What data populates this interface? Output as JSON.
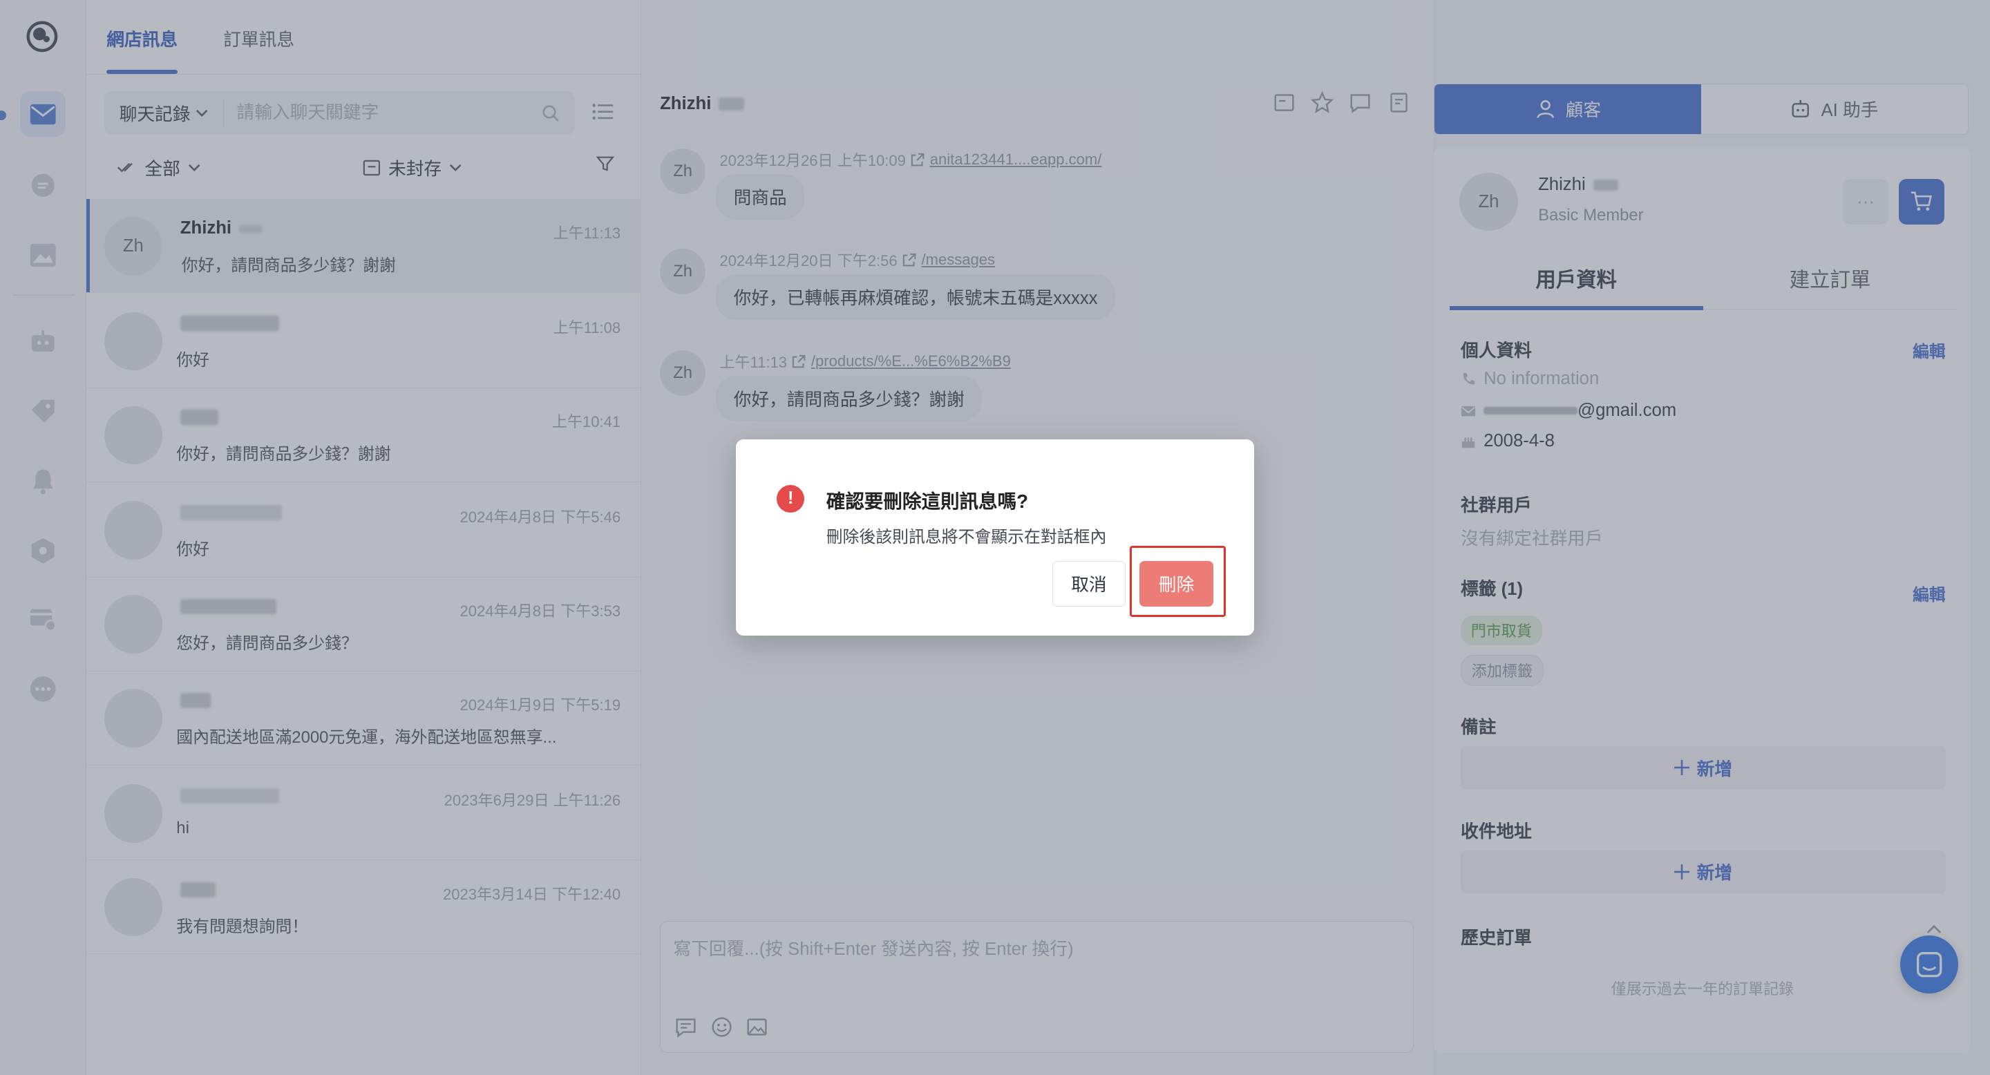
{
  "nav": {
    "tabs": [
      {
        "label": "網店訊息",
        "active": true
      },
      {
        "label": "訂單訊息",
        "active": false
      }
    ],
    "rail_icons": [
      "mail-icon",
      "chat-icon",
      "image-icon",
      "robot-icon",
      "tag-icon",
      "bell-icon",
      "package-icon",
      "card-settings-icon",
      "more-icon"
    ]
  },
  "search": {
    "scope_label": "聊天記錄",
    "placeholder": "請輸入聊天關鍵字"
  },
  "filters": {
    "all_label": "全部",
    "archive_label": "未封存"
  },
  "conversations": [
    {
      "avatar": "Zh",
      "name": "Zhizhi",
      "time": "上午11:13",
      "message": "你好，請問商品多少錢？謝謝",
      "active": true
    },
    {
      "avatar": "",
      "name": "",
      "time": "上午11:08",
      "message": "你好",
      "active": false
    },
    {
      "avatar": "",
      "name": "",
      "time": "上午10:41",
      "message": "你好，請問商品多少錢？謝謝",
      "active": false
    },
    {
      "avatar": "",
      "name": "",
      "time": "2024年4月8日 下午5:46",
      "message": "你好",
      "active": false
    },
    {
      "avatar": "",
      "name": "",
      "time": "2024年4月8日 下午3:53",
      "message": "您好，請問商品多少錢？",
      "active": false
    },
    {
      "avatar": "",
      "name": "",
      "time": "2024年1月9日 下午5:19",
      "message": "國內配送地區滿2000元免運，海外配送地區恕無享...",
      "active": false
    },
    {
      "avatar": "",
      "name": "",
      "time": "2023年6月29日 上午11:26",
      "message": "hi",
      "active": false
    },
    {
      "avatar": "",
      "name": "",
      "time": "2023年3月14日 下午12:40",
      "message": "我有問題想詢問！",
      "active": false
    }
  ],
  "chat": {
    "contact_name": "Zhizhi",
    "messages": [
      {
        "avatar": "Zh",
        "time": "2023年12月26日 上午10:09",
        "link": "anita123441....eapp.com/",
        "text": "問商品"
      },
      {
        "avatar": "Zh",
        "time": "2024年12月20日 下午2:56",
        "link": "/messages",
        "text": "你好，已轉帳再麻煩確認，帳號末五碼是xxxxx"
      },
      {
        "avatar": "Zh",
        "time": "上午11:13",
        "link": "/products/%E...%E6%B2%B9",
        "text": "你好，請問商品多少錢？謝謝"
      }
    ],
    "composer_placeholder": "寫下回覆...(按 Shift+Enter 發送內容, 按 Enter 換行)"
  },
  "right_panel": {
    "tabs": [
      {
        "label": "顧客",
        "active": true
      },
      {
        "label": "AI 助手",
        "active": false
      }
    ],
    "profile": {
      "avatar": "Zh",
      "name": "Zhizhi",
      "level": "Basic Member",
      "more": "···"
    },
    "sub_tabs": [
      {
        "label": "用戶資料",
        "active": true
      },
      {
        "label": "建立訂單",
        "active": false
      }
    ],
    "personal": {
      "title": "個人資料",
      "edit": "編輯",
      "phone": "No information",
      "email_suffix": "@gmail.com",
      "birthday": "2008-4-8"
    },
    "social": {
      "title": "社群用戶",
      "value": "沒有綁定社群用戶"
    },
    "tags": {
      "title": "標籤 (1)",
      "edit": "編輯",
      "items": [
        "門市取貨"
      ],
      "add_label": "添加標籤"
    },
    "notes": {
      "title": "備註",
      "add_label": "新增"
    },
    "address": {
      "title": "收件地址",
      "add_label": "新增"
    },
    "history": {
      "title": "歷史訂單",
      "note": "僅展示過去一年的訂單記錄"
    }
  },
  "dialog": {
    "title": "確認要刪除這則訊息嗎?",
    "body": "刪除後該則訊息將不會顯示在對話框內",
    "cancel_label": "取消",
    "confirm_label": "刪除",
    "confirm_color": "#ee7c76",
    "warning_color": "#e54b4b"
  },
  "colors": {
    "accent": "#3d6ad0",
    "highlight_box": "#e0352b"
  }
}
